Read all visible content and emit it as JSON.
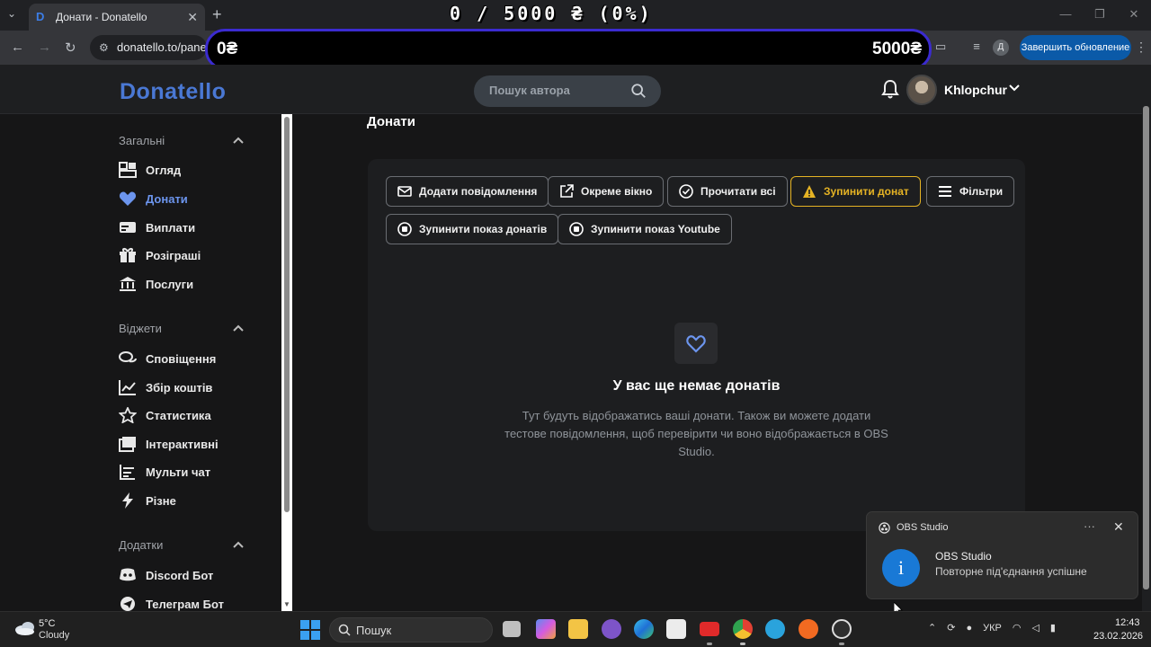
{
  "browser": {
    "tab_title": "Донати - Donatello",
    "tab_favicon": "D",
    "tab_close": "✕",
    "new_tab": "+",
    "url": "donatello.to/panel",
    "update_button": "Завершить обновление",
    "profile_initial": "Д"
  },
  "stream_overlay": {
    "counter": "0 / 5000 ₴ (0%)",
    "progress_left": "0₴",
    "progress_right": "5000₴",
    "progress_fraction": 0
  },
  "header": {
    "logo": "Donatello",
    "search_placeholder": "Пошук автора",
    "username": "Khlopchur",
    "accent": "#4a78d4"
  },
  "sidebar": {
    "sections": [
      {
        "title": "Загальні",
        "items": [
          {
            "label": "Огляд",
            "icon": "dashboard-icon"
          },
          {
            "label": "Донати",
            "icon": "heart-icon",
            "active": true
          },
          {
            "label": "Виплати",
            "icon": "card-icon"
          },
          {
            "label": "Розіграші",
            "icon": "gift-icon"
          },
          {
            "label": "Послуги",
            "icon": "bank-icon"
          }
        ]
      },
      {
        "title": "Віджети",
        "items": [
          {
            "label": "Сповіщення",
            "icon": "chat-icon"
          },
          {
            "label": "Збір коштів",
            "icon": "chart-line-icon"
          },
          {
            "label": "Статистика",
            "icon": "star-icon"
          },
          {
            "label": "Інтерактивні",
            "icon": "images-icon"
          },
          {
            "label": "Мульти чат",
            "icon": "list-icon"
          },
          {
            "label": "Різне",
            "icon": "bolt-icon"
          }
        ]
      },
      {
        "title": "Додатки",
        "items": [
          {
            "label": "Discord Бот",
            "icon": "discord-icon"
          },
          {
            "label": "Телеграм Бот",
            "icon": "telegram-icon"
          }
        ]
      }
    ]
  },
  "main": {
    "title": "Донати",
    "buttons": [
      {
        "label": "Додати повідомлення",
        "icon": "envelope-icon"
      },
      {
        "label": "Окреме вікно",
        "icon": "external-link-icon"
      },
      {
        "label": "Прочитати всі",
        "icon": "check-circle-icon"
      },
      {
        "label": "Зупинити донат",
        "icon": "warning-icon",
        "warning": true
      },
      {
        "label": "Фільтри",
        "icon": "menu-icon"
      },
      {
        "label": "Зупинити показ донатів",
        "icon": "stop-circle-icon"
      },
      {
        "label": "Зупинити показ Youtube",
        "icon": "stop-circle-icon"
      }
    ],
    "empty_title": "У вас ще немає донатів",
    "empty_desc": "Тут будуть відображатись ваші донати. Також ви можете додати тестове повідомлення, щоб перевірити чи воно відображається в OBS Studio.",
    "warning_color": "#e5b324"
  },
  "toast": {
    "app": "OBS Studio",
    "title": "OBS Studio",
    "message": "Повторне під'єднання успішне",
    "more": "···",
    "close": "✕"
  },
  "taskbar": {
    "temperature": "5°C",
    "weather": "Cloudy",
    "search": "Пошук",
    "language": "УКР",
    "time": "12:43",
    "date": "23.02.2026"
  }
}
